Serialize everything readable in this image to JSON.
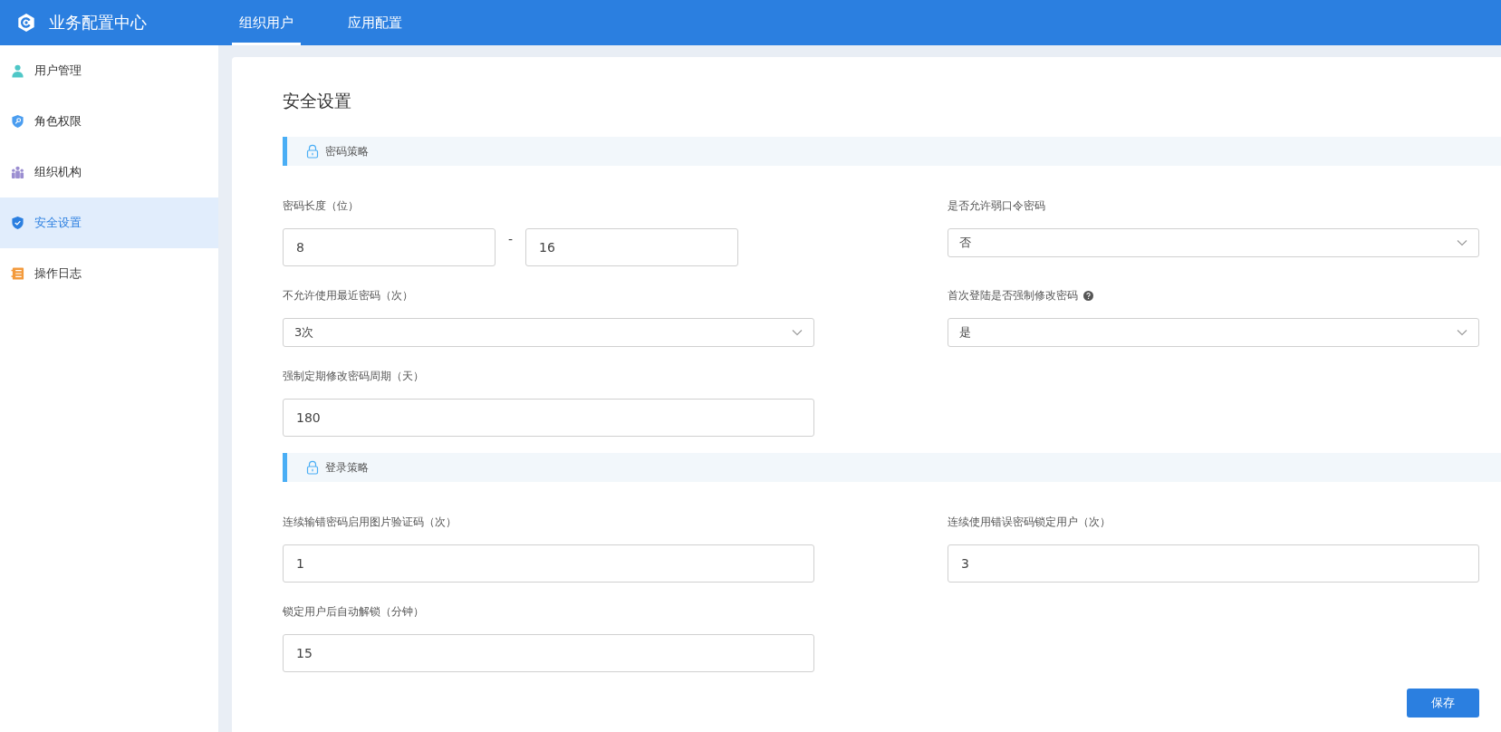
{
  "header": {
    "title": "业务配置中心",
    "tabs": [
      {
        "label": "组织用户",
        "selected": true
      },
      {
        "label": "应用配置",
        "selected": false
      }
    ]
  },
  "sidebar": {
    "items": [
      {
        "label": "用户管理",
        "kind": "user",
        "selected": false
      },
      {
        "label": "角色权限",
        "kind": "shield-key",
        "selected": false
      },
      {
        "label": "组织机构",
        "kind": "people",
        "selected": false
      },
      {
        "label": "安全设置",
        "kind": "shield-check",
        "selected": true
      },
      {
        "label": "操作日志",
        "kind": "list",
        "selected": false
      }
    ]
  },
  "page_title": "安全设置",
  "sections": [
    {
      "title": "密码策略",
      "fields": [
        {
          "kind": "range",
          "label": "密码长度（位）",
          "values": [
            "8",
            "16"
          ],
          "separator": "-"
        },
        {
          "kind": "select",
          "label": "是否允许弱口令密码",
          "value": "否"
        },
        {
          "kind": "select",
          "label": "不允许使用最近密码（次）",
          "value": "3次"
        },
        {
          "kind": "select",
          "label": "首次登陆是否强制修改密码",
          "value": "是",
          "help": true
        },
        {
          "kind": "input",
          "label": "强制定期修改密码周期（天）",
          "value": "180"
        }
      ]
    },
    {
      "title": "登录策略",
      "fields": [
        {
          "kind": "input",
          "label": "连续输错密码启用图片验证码（次）",
          "value": "1"
        },
        {
          "kind": "input",
          "label": "连续使用错误密码锁定用户（次）",
          "value": "3"
        },
        {
          "kind": "input",
          "label": "锁定用户后自动解锁（分钟）",
          "value": "15"
        }
      ]
    }
  ],
  "save_button": "保存"
}
